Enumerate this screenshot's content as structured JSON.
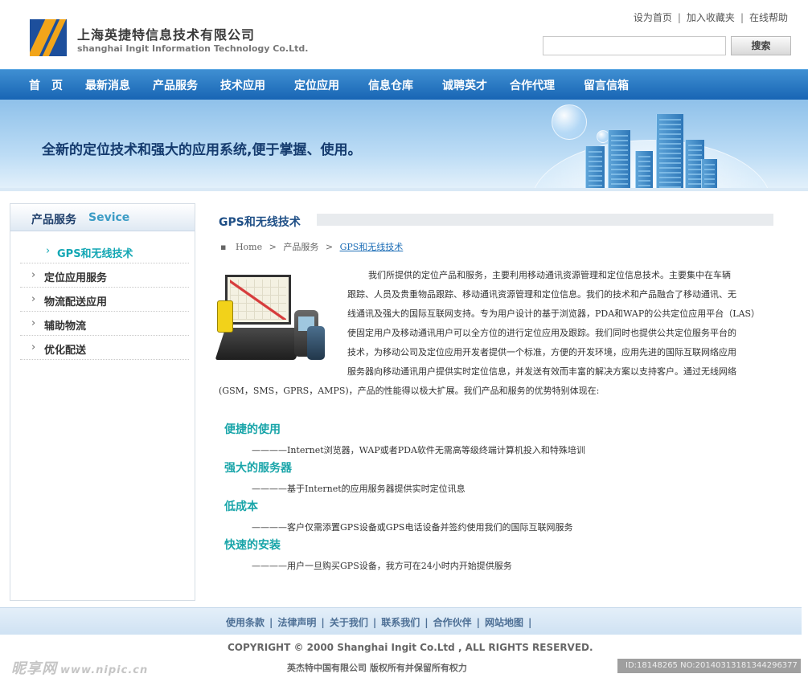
{
  "header": {
    "company_cn": "上海英捷特信息技术有限公司",
    "company_en": "shanghai Ingit Information Technology Co.Ltd.",
    "top_links": [
      "设为首页",
      "加入收藏夹",
      "在线帮助"
    ],
    "search_value": "",
    "search_button": "搜索"
  },
  "nav": {
    "items": [
      "首　页",
      "最新消息",
      "产品服务",
      "技术应用",
      "定位应用",
      "信息仓库",
      "诚聘英才",
      "合作代理",
      "留言信箱"
    ]
  },
  "banner": {
    "slogan": "全新的定位技术和强大的应用系统,便于掌握、使用。"
  },
  "sidebar": {
    "title_cn": "产品服务",
    "title_en": "Sevice",
    "items": [
      {
        "label": "GPS和无线技术",
        "active": true
      },
      {
        "label": "定位应用服务",
        "active": false
      },
      {
        "label": "物流配送应用",
        "active": false
      },
      {
        "label": "辅助物流",
        "active": false
      },
      {
        "label": "优化配送",
        "active": false
      }
    ]
  },
  "main": {
    "title": "GPS和无线技术",
    "breadcrumb": {
      "bullet": "▪",
      "home": "Home",
      "section": "产品服务",
      "current": "GPS和无线技术",
      "separator": ">"
    },
    "intro_lines": [
      "我们所提供的定位产品和服务，主要利用移动通讯资源管理和定位信息技术。主要集中在车辆",
      "跟踪、人员及贵重物品跟踪、移动通讯资源管理和定位信息。我们的技术和产品融合了移动通讯、无",
      "线通讯及强大的国际互联网支持。专为用户设计的基于浏览器，PDA和WAP的公共定位应用平台（LAS）",
      "使固定用户及移动通讯用户可以全方位的进行定位应用及跟踪。我们同时也提供公共定位服务平台的",
      "技术，为移动公司及定位应用开发者提供一个标准，方便的开发环境，应用先进的国际互联网络应用",
      "服务器向移动通讯用户提供实时定位信息，并发送有效而丰富的解决方案以支持客户。通过无线网络",
      "(GSM，SMS，GPRS，AMPS)，产品的性能得以极大扩展。我们产品和服务的优势特别体现在:"
    ],
    "features": [
      {
        "title": "便捷的使用",
        "desc": "————Internet浏览器，WAP或者PDA软件无需高等级终端计算机投入和特殊培训"
      },
      {
        "title": "强大的服务器",
        "desc": "————基于Internet的应用服务器提供实时定位讯息"
      },
      {
        "title": "低成本",
        "desc": "————客户仅需添置GPS设备或GPS电话设备并签约使用我们的国际互联网服务"
      },
      {
        "title": "快速的安装",
        "desc": "————用户一旦购买GPS设备，我方可在24小时内开始提供服务"
      }
    ]
  },
  "footer": {
    "links": [
      "使用条款",
      "法律声明",
      "关于我们",
      "联系我们",
      "合作伙伴",
      "网站地图"
    ],
    "link_separator": "|",
    "copyright": "COPYRIGHT © 2000 Shanghai Ingit Co.Ltd , ALL RIGHTS RESERVED.",
    "rights_cn": "英杰特中国有限公司 版权所有并保留所有权力"
  },
  "watermark": {
    "brand": "昵享网",
    "site": "www.nipic.cn",
    "id_text": "ID:18148265 NO:20140313181344296377"
  },
  "colors": {
    "nav_blue": "#1865b4",
    "accent_teal": "#19a5a9",
    "title_blue": "#1f4f86",
    "logo_blue": "#1d4f9c",
    "logo_orange": "#f2a51a"
  }
}
